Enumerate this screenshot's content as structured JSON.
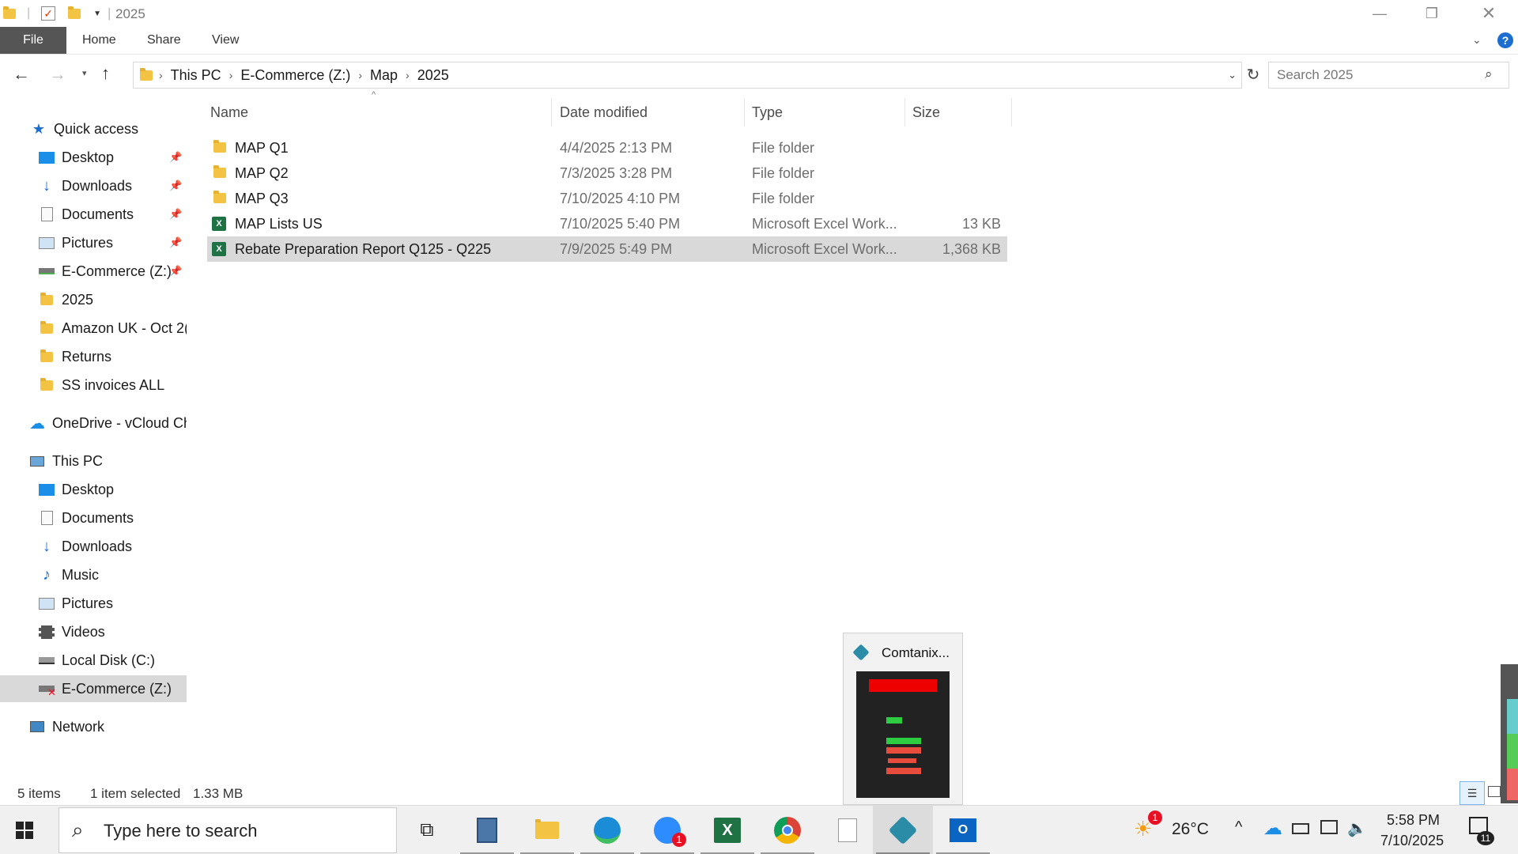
{
  "window": {
    "title": "2025",
    "buttons": {
      "minimize": "—",
      "restore": "❐",
      "close": "✕"
    }
  },
  "ribbon": {
    "tabs": [
      "File",
      "Home",
      "Share",
      "View"
    ],
    "help": "?"
  },
  "address": {
    "crumbs": [
      "This PC",
      "E-Commerce (Z:)",
      "Map",
      "2025"
    ],
    "search_placeholder": "Search 2025"
  },
  "sidebar": {
    "quick_access": "Quick access",
    "quick_items": [
      "Desktop",
      "Downloads",
      "Documents",
      "Pictures",
      "E-Commerce (Z:)",
      "2025",
      "Amazon UK - Oct 2(",
      "Returns",
      "SS invoices ALL"
    ],
    "onedrive": "OneDrive - vCloud Ch",
    "this_pc": "This PC",
    "pc_items": [
      "Desktop",
      "Documents",
      "Downloads",
      "Music",
      "Pictures",
      "Videos",
      "Local Disk (C:)",
      "E-Commerce (Z:)"
    ],
    "network": "Network"
  },
  "columns": {
    "name": "Name",
    "date": "Date modified",
    "type": "Type",
    "size": "Size"
  },
  "files": [
    {
      "name": "MAP Q1",
      "date": "4/4/2025 2:13 PM",
      "type": "File folder",
      "size": "",
      "icon": "folder-icon"
    },
    {
      "name": "MAP Q2",
      "date": "7/3/2025 3:28 PM",
      "type": "File folder",
      "size": "",
      "icon": "folder-icon"
    },
    {
      "name": "MAP Q3",
      "date": "7/10/2025 4:10 PM",
      "type": "File folder",
      "size": "",
      "icon": "folder-icon"
    },
    {
      "name": "MAP Lists US",
      "date": "7/10/2025 5:40 PM",
      "type": "Microsoft Excel Work...",
      "size": "13 KB",
      "icon": "excel-icon"
    },
    {
      "name": "Rebate Preparation Report Q125 - Q225",
      "date": "7/9/2025 5:49 PM",
      "type": "Microsoft Excel Work...",
      "size": "1,368 KB",
      "icon": "excel-icon",
      "selected": true
    }
  ],
  "status": {
    "items": "5 items",
    "selected": "1 item selected",
    "size": "1.33 MB"
  },
  "popup": {
    "title": "Comtanix..."
  },
  "taskbar": {
    "search_placeholder": "Type here to search",
    "weather": "26°C",
    "weather_badge": "1",
    "time": "5:58 PM",
    "date": "7/10/2025",
    "zoom_badge": "1",
    "notif_count": "11"
  }
}
